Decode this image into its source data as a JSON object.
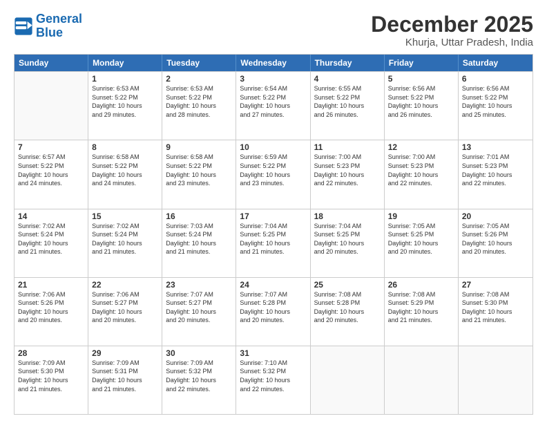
{
  "logo": {
    "line1": "General",
    "line2": "Blue"
  },
  "title": "December 2025",
  "subtitle": "Khurja, Uttar Pradesh, India",
  "header_days": [
    "Sunday",
    "Monday",
    "Tuesday",
    "Wednesday",
    "Thursday",
    "Friday",
    "Saturday"
  ],
  "weeks": [
    [
      {
        "day": "",
        "info": ""
      },
      {
        "day": "1",
        "info": "Sunrise: 6:53 AM\nSunset: 5:22 PM\nDaylight: 10 hours\nand 29 minutes."
      },
      {
        "day": "2",
        "info": "Sunrise: 6:53 AM\nSunset: 5:22 PM\nDaylight: 10 hours\nand 28 minutes."
      },
      {
        "day": "3",
        "info": "Sunrise: 6:54 AM\nSunset: 5:22 PM\nDaylight: 10 hours\nand 27 minutes."
      },
      {
        "day": "4",
        "info": "Sunrise: 6:55 AM\nSunset: 5:22 PM\nDaylight: 10 hours\nand 26 minutes."
      },
      {
        "day": "5",
        "info": "Sunrise: 6:56 AM\nSunset: 5:22 PM\nDaylight: 10 hours\nand 26 minutes."
      },
      {
        "day": "6",
        "info": "Sunrise: 6:56 AM\nSunset: 5:22 PM\nDaylight: 10 hours\nand 25 minutes."
      }
    ],
    [
      {
        "day": "7",
        "info": "Sunrise: 6:57 AM\nSunset: 5:22 PM\nDaylight: 10 hours\nand 24 minutes."
      },
      {
        "day": "8",
        "info": "Sunrise: 6:58 AM\nSunset: 5:22 PM\nDaylight: 10 hours\nand 24 minutes."
      },
      {
        "day": "9",
        "info": "Sunrise: 6:58 AM\nSunset: 5:22 PM\nDaylight: 10 hours\nand 23 minutes."
      },
      {
        "day": "10",
        "info": "Sunrise: 6:59 AM\nSunset: 5:22 PM\nDaylight: 10 hours\nand 23 minutes."
      },
      {
        "day": "11",
        "info": "Sunrise: 7:00 AM\nSunset: 5:23 PM\nDaylight: 10 hours\nand 22 minutes."
      },
      {
        "day": "12",
        "info": "Sunrise: 7:00 AM\nSunset: 5:23 PM\nDaylight: 10 hours\nand 22 minutes."
      },
      {
        "day": "13",
        "info": "Sunrise: 7:01 AM\nSunset: 5:23 PM\nDaylight: 10 hours\nand 22 minutes."
      }
    ],
    [
      {
        "day": "14",
        "info": "Sunrise: 7:02 AM\nSunset: 5:24 PM\nDaylight: 10 hours\nand 21 minutes."
      },
      {
        "day": "15",
        "info": "Sunrise: 7:02 AM\nSunset: 5:24 PM\nDaylight: 10 hours\nand 21 minutes."
      },
      {
        "day": "16",
        "info": "Sunrise: 7:03 AM\nSunset: 5:24 PM\nDaylight: 10 hours\nand 21 minutes."
      },
      {
        "day": "17",
        "info": "Sunrise: 7:04 AM\nSunset: 5:25 PM\nDaylight: 10 hours\nand 21 minutes."
      },
      {
        "day": "18",
        "info": "Sunrise: 7:04 AM\nSunset: 5:25 PM\nDaylight: 10 hours\nand 20 minutes."
      },
      {
        "day": "19",
        "info": "Sunrise: 7:05 AM\nSunset: 5:25 PM\nDaylight: 10 hours\nand 20 minutes."
      },
      {
        "day": "20",
        "info": "Sunrise: 7:05 AM\nSunset: 5:26 PM\nDaylight: 10 hours\nand 20 minutes."
      }
    ],
    [
      {
        "day": "21",
        "info": "Sunrise: 7:06 AM\nSunset: 5:26 PM\nDaylight: 10 hours\nand 20 minutes."
      },
      {
        "day": "22",
        "info": "Sunrise: 7:06 AM\nSunset: 5:27 PM\nDaylight: 10 hours\nand 20 minutes."
      },
      {
        "day": "23",
        "info": "Sunrise: 7:07 AM\nSunset: 5:27 PM\nDaylight: 10 hours\nand 20 minutes."
      },
      {
        "day": "24",
        "info": "Sunrise: 7:07 AM\nSunset: 5:28 PM\nDaylight: 10 hours\nand 20 minutes."
      },
      {
        "day": "25",
        "info": "Sunrise: 7:08 AM\nSunset: 5:28 PM\nDaylight: 10 hours\nand 20 minutes."
      },
      {
        "day": "26",
        "info": "Sunrise: 7:08 AM\nSunset: 5:29 PM\nDaylight: 10 hours\nand 21 minutes."
      },
      {
        "day": "27",
        "info": "Sunrise: 7:08 AM\nSunset: 5:30 PM\nDaylight: 10 hours\nand 21 minutes."
      }
    ],
    [
      {
        "day": "28",
        "info": "Sunrise: 7:09 AM\nSunset: 5:30 PM\nDaylight: 10 hours\nand 21 minutes."
      },
      {
        "day": "29",
        "info": "Sunrise: 7:09 AM\nSunset: 5:31 PM\nDaylight: 10 hours\nand 21 minutes."
      },
      {
        "day": "30",
        "info": "Sunrise: 7:09 AM\nSunset: 5:32 PM\nDaylight: 10 hours\nand 22 minutes."
      },
      {
        "day": "31",
        "info": "Sunrise: 7:10 AM\nSunset: 5:32 PM\nDaylight: 10 hours\nand 22 minutes."
      },
      {
        "day": "",
        "info": ""
      },
      {
        "day": "",
        "info": ""
      },
      {
        "day": "",
        "info": ""
      }
    ]
  ]
}
